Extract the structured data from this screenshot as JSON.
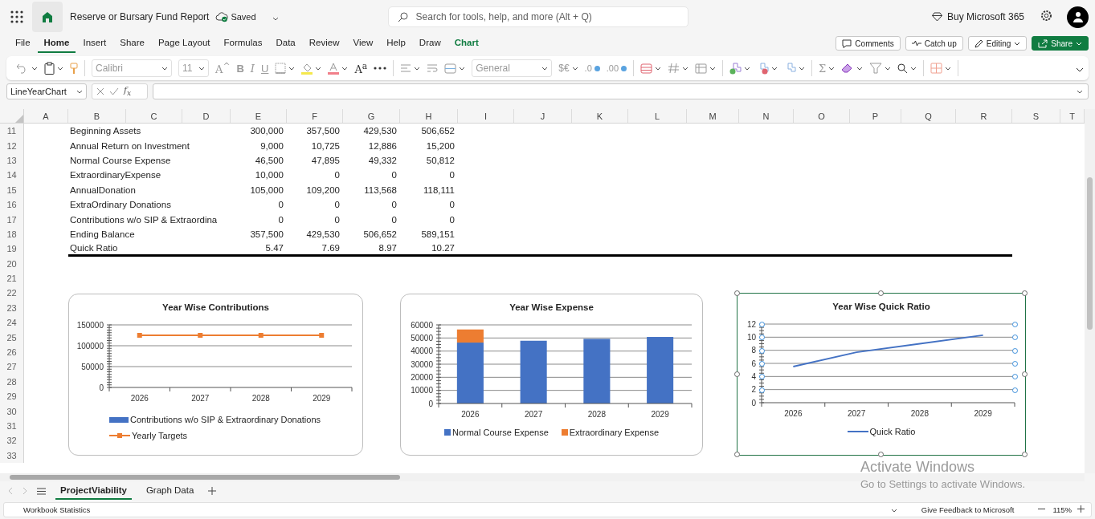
{
  "app_bar": {
    "title": "Reserve or Bursary Fund Report",
    "save_status": "Saved",
    "search": {
      "placeholder": "Search for tools, help, and more (Alt + Q)"
    },
    "buy": "Buy Microsoft 365"
  },
  "menu": {
    "tabs": [
      {
        "label": "File",
        "selected": false,
        "contextual": false
      },
      {
        "label": "Home",
        "selected": true,
        "contextual": false
      },
      {
        "label": "Insert",
        "selected": false,
        "contextual": false
      },
      {
        "label": "Share",
        "selected": false,
        "contextual": false
      },
      {
        "label": "Page Layout",
        "selected": false,
        "contextual": false
      },
      {
        "label": "Formulas",
        "selected": false,
        "contextual": false
      },
      {
        "label": "Data",
        "selected": false,
        "contextual": false
      },
      {
        "label": "Review",
        "selected": false,
        "contextual": false
      },
      {
        "label": "View",
        "selected": false,
        "contextual": false
      },
      {
        "label": "Help",
        "selected": false,
        "contextual": false
      },
      {
        "label": "Draw",
        "selected": false,
        "contextual": false
      },
      {
        "label": "Chart",
        "selected": false,
        "contextual": true
      }
    ],
    "actions": [
      {
        "label": "Comments",
        "kind": "comments"
      },
      {
        "label": "Catch up",
        "kind": "catchup"
      },
      {
        "label": "Editing",
        "kind": "editing"
      },
      {
        "label": "Share",
        "kind": "share"
      }
    ]
  },
  "ribbon": {
    "font_name": "Calibri",
    "font_size": "11",
    "grow_font": "A$^{^}$",
    "bold": "B",
    "italic": "I",
    "underline": "U",
    "superscript": "A$^{a}$",
    "number_format": "General",
    "currency": "$€",
    "decrease_decimal": ".0",
    "increase_decimal": ".00",
    "sum": "Σ"
  },
  "formula_bar": {
    "name_box": "LineYearChart",
    "function": "f$_{x}$"
  },
  "sheet": {
    "columns": [
      "A",
      "B",
      "C",
      "D",
      "E",
      "F",
      "G",
      "H",
      "I",
      "J",
      "K",
      "L",
      "M",
      "N",
      "O",
      "P",
      "Q",
      "R",
      "S",
      "T"
    ],
    "rows": [
      {
        "number": "11",
        "label": "Beginning Assets",
        "values": [
          "300,000",
          "357,500",
          "429,530",
          "506,652"
        ],
        "underline": false
      },
      {
        "number": "12",
        "label": "Annual Return on Investment",
        "values": [
          "9,000",
          "10,725",
          "12,886",
          "15,200"
        ],
        "underline": false
      },
      {
        "number": "13",
        "label": "Normal Course Expense",
        "values": [
          "46,500",
          "47,895",
          "49,332",
          "50,812"
        ],
        "underline": false
      },
      {
        "number": "14",
        "label": "ExtraordinaryExpense",
        "values": [
          "10,000",
          "0",
          "0",
          "0"
        ],
        "underline": false
      },
      {
        "number": "15",
        "label": "AnnualDonation",
        "values": [
          "105,000",
          "109,200",
          "113,568",
          "118,111"
        ],
        "underline": false
      },
      {
        "number": "16",
        "label": "ExtraOrdinary Donations",
        "values": [
          "0",
          "0",
          "0",
          "0"
        ],
        "underline": false
      },
      {
        "number": "17",
        "label": "Contributions w/o SIP & Extraordina",
        "values": [
          "0",
          "0",
          "0",
          "0"
        ],
        "underline": false
      },
      {
        "number": "18",
        "label": "Ending Balance",
        "values": [
          "357,500",
          "429,530",
          "506,652",
          "589,151"
        ],
        "underline": false
      },
      {
        "number": "19",
        "label": "Quick Ratio",
        "values": [
          "5.47",
          "7.69",
          "8.97",
          "10.27"
        ],
        "underline": true
      },
      {
        "number": "20"
      },
      {
        "number": "21"
      },
      {
        "number": "22"
      },
      {
        "number": "23"
      },
      {
        "number": "24"
      },
      {
        "number": "25"
      },
      {
        "number": "26"
      },
      {
        "number": "27"
      },
      {
        "number": "28"
      },
      {
        "number": "29"
      },
      {
        "number": "30"
      },
      {
        "number": "31"
      },
      {
        "number": "32"
      },
      {
        "number": "33"
      }
    ]
  },
  "charts": [
    {
      "selected": false,
      "chart_data": {
        "type": "bar",
        "title": "Year Wise Contributions",
        "categories": [
          "2026",
          "2027",
          "2028",
          "2029"
        ],
        "ylim": [
          0,
          150000
        ],
        "yticks": [
          0,
          50000,
          100000,
          150000
        ],
        "grid": true,
        "legend": "bottom",
        "series": [
          {
            "name": "Contributions w/o SIP & Extraordinary Donations",
            "color": "#4472c4",
            "values": [
              0,
              0,
              0,
              0
            ]
          },
          {
            "name": "Yearly Targets",
            "color": "#ed7d31",
            "type": "line",
            "marker": "square",
            "values": [
              125000,
              125000,
              125000,
              125000
            ]
          }
        ]
      }
    },
    {
      "selected": false,
      "chart_data": {
        "type": "bar",
        "title": "Year Wise Expense",
        "categories": [
          "2026",
          "2027",
          "2028",
          "2029"
        ],
        "ylim": [
          0,
          60000
        ],
        "yticks": [
          0,
          10000,
          20000,
          30000,
          40000,
          50000,
          60000
        ],
        "stacked": true,
        "grid": true,
        "legend": "bottom",
        "series": [
          {
            "name": "Normal Course Expense",
            "color": "#4472c4",
            "values": [
              46500,
              47900,
              49300,
              50800
            ]
          },
          {
            "name": "Extraordinary Expense",
            "color": "#ed7d31",
            "values": [
              10000,
              0,
              0,
              0
            ]
          }
        ]
      }
    },
    {
      "selected": true,
      "chart_data": {
        "type": "line",
        "title": "Year Wise Quick Ratio",
        "categories": [
          "2026",
          "2027",
          "2028",
          "2029"
        ],
        "ylim": [
          0,
          12
        ],
        "yticks": [
          0,
          2,
          4,
          6,
          8,
          10,
          12
        ],
        "grid": true,
        "legend": "bottom",
        "series": [
          {
            "name": "Quick Ratio",
            "color": "#4472c4",
            "values": [
              5.5,
              7.7,
              9.0,
              10.3
            ]
          }
        ]
      }
    }
  ],
  "sheet_tabs": [
    {
      "label": "ProjectViability",
      "selected": true
    },
    {
      "label": "Graph Data",
      "selected": false
    }
  ],
  "status_bar": {
    "left": "Workbook Statistics",
    "feedback": "Give Feedback to Microsoft",
    "zoom": "115%"
  },
  "activation_notice": {
    "title": "Activate Windows",
    "message": "Go to Settings to activate Windows."
  }
}
